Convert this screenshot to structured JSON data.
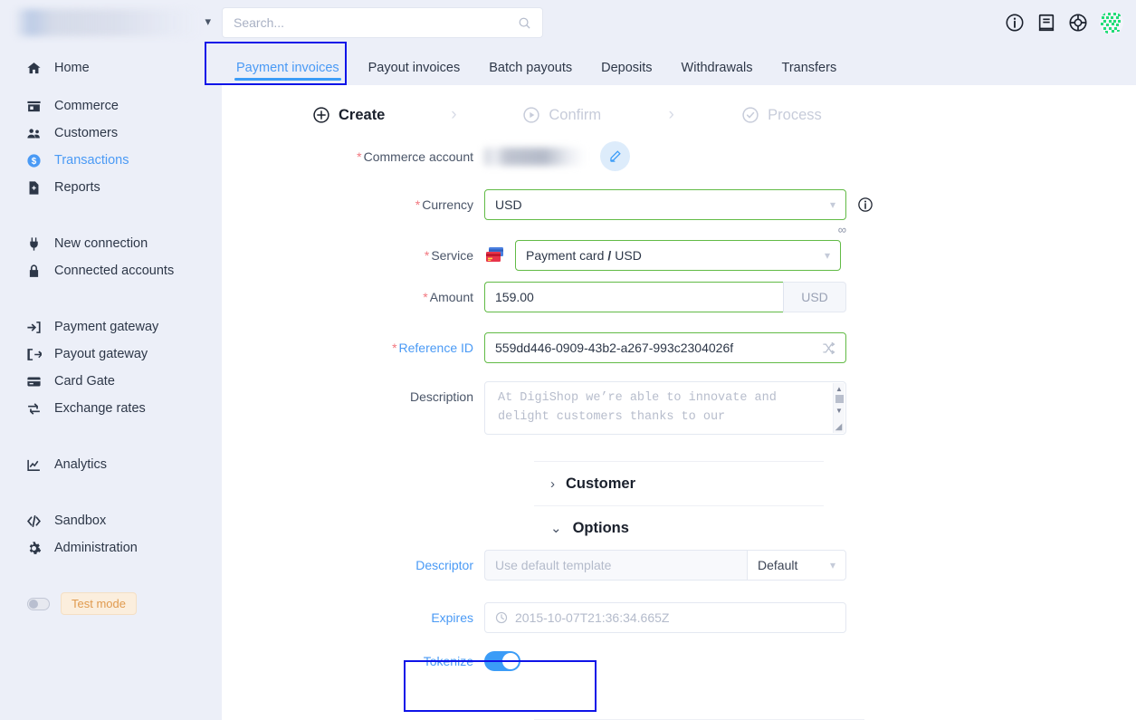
{
  "sidebar": {
    "brand_redacted": true,
    "groups": [
      {
        "items": [
          {
            "label": "Home",
            "icon": "home-icon",
            "active": false
          }
        ]
      },
      {
        "items": [
          {
            "label": "Commerce",
            "icon": "store-icon",
            "active": false
          },
          {
            "label": "Customers",
            "icon": "users-icon",
            "active": false
          },
          {
            "label": "Transactions",
            "icon": "dollar-circle-icon",
            "active": true
          },
          {
            "label": "Reports",
            "icon": "report-file-icon",
            "active": false
          }
        ]
      },
      {
        "items": [
          {
            "label": "New connection",
            "icon": "plug-icon",
            "active": false
          },
          {
            "label": "Connected accounts",
            "icon": "lock-icon",
            "active": false
          }
        ]
      },
      {
        "items": [
          {
            "label": "Payment gateway",
            "icon": "sign-in-icon",
            "active": false
          },
          {
            "label": "Payout gateway",
            "icon": "sign-out-icon",
            "active": false
          },
          {
            "label": "Card Gate",
            "icon": "credit-card-icon",
            "active": false
          },
          {
            "label": "Exchange rates",
            "icon": "exchange-icon",
            "active": false
          }
        ]
      },
      {
        "items": [
          {
            "label": "Analytics",
            "icon": "chart-line-icon",
            "active": false
          }
        ]
      },
      {
        "items": [
          {
            "label": "Sandbox",
            "icon": "code-icon",
            "active": false
          },
          {
            "label": "Administration",
            "icon": "gear-icon",
            "active": false
          }
        ]
      }
    ],
    "test_mode": {
      "label": "Test mode",
      "enabled": false
    }
  },
  "topbar": {
    "search_placeholder": "Search...",
    "search_value": "",
    "icons": [
      {
        "name": "info-circle-icon"
      },
      {
        "name": "book-icon"
      },
      {
        "name": "lifebuoy-icon"
      }
    ],
    "avatar": {
      "name": "user-avatar",
      "color": "#22dd77"
    }
  },
  "tabs": [
    {
      "label": "Payment invoices",
      "active": true,
      "highlighted": true
    },
    {
      "label": "Payout invoices",
      "active": false
    },
    {
      "label": "Batch payouts",
      "active": false
    },
    {
      "label": "Deposits",
      "active": false
    },
    {
      "label": "Withdrawals",
      "active": false
    },
    {
      "label": "Transfers",
      "active": false
    }
  ],
  "stepper": {
    "steps": [
      {
        "label": "Create",
        "icon": "plus-circle-icon",
        "state": "active"
      },
      {
        "label": "Confirm",
        "icon": "play-circle-icon",
        "state": "inactive"
      },
      {
        "label": "Process",
        "icon": "check-circle-icon",
        "state": "inactive"
      }
    ],
    "separator": "›"
  },
  "form": {
    "commerce_account": {
      "label": "Commerce account",
      "required": true,
      "value_redacted": true,
      "edit_button": "pencil-icon"
    },
    "currency": {
      "label": "Currency",
      "required": true,
      "value": "USD",
      "info_icon": "info-circle-icon",
      "hint": "∞"
    },
    "service": {
      "label": "Service",
      "required": true,
      "icon": "credit-cards-icon",
      "value_primary": "Payment card",
      "value_separator": "/",
      "value_secondary": "USD"
    },
    "amount": {
      "label": "Amount",
      "required": true,
      "value": "159.00",
      "suffix": "USD"
    },
    "reference_id": {
      "label": "Reference ID",
      "required": true,
      "value": "559dd446-0909-43b2-a267-993c2304026f",
      "action_icon": "shuffle-icon"
    },
    "description": {
      "label": "Description",
      "required": false,
      "value": "",
      "placeholder": "At DigiShop we’re able to innovate and delight customers thanks to our"
    }
  },
  "sections": {
    "customer": {
      "label": "Customer",
      "expanded": false,
      "chevron": "›"
    },
    "options": {
      "label": "Options",
      "expanded": true,
      "chevron": "⌄"
    }
  },
  "options": {
    "descriptor": {
      "label": "Descriptor",
      "placeholder": "Use default template",
      "value": "",
      "select_value": "Default"
    },
    "expires": {
      "label": "Expires",
      "value": "",
      "placeholder": "2015-10-07T21:36:34.665Z",
      "icon": "clock-icon"
    },
    "tokenize": {
      "label": "Tokenize",
      "enabled": true,
      "highlighted": true
    }
  },
  "colors": {
    "sidebar_bg": "#eceff8",
    "accent_blue": "#3b9cf7",
    "valid_border": "#62bb46",
    "required_star": "#f2777f",
    "highlight_box": "#0f14e8",
    "test_mode_text": "#e09a4e"
  }
}
